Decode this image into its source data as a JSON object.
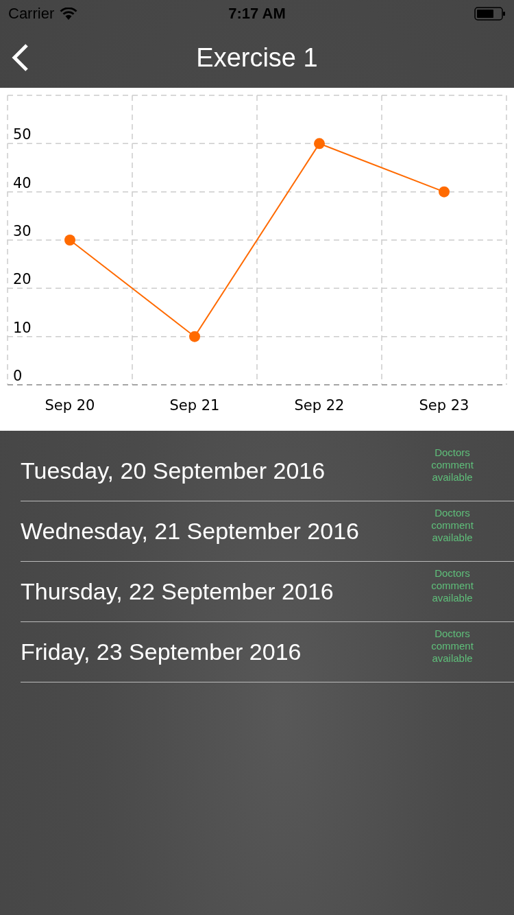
{
  "status_bar": {
    "carrier": "Carrier",
    "time": "7:17 AM"
  },
  "nav": {
    "title": "Exercise 1"
  },
  "chart": {
    "chart_data": {
      "type": "line",
      "categories": [
        "Sep 20",
        "Sep 21",
        "Sep 22",
        "Sep 23"
      ],
      "grid": true,
      "series": [
        {
          "color": "#ff6a00",
          "marker": true,
          "values": [
            30,
            10,
            50,
            40
          ]
        }
      ],
      "ylim": [
        0,
        60
      ],
      "yticks": [
        0,
        10,
        20,
        30,
        40,
        50
      ]
    }
  },
  "entries": [
    {
      "date": "Tuesday, 20 September 2016",
      "note": "Doctors comment available"
    },
    {
      "date": "Wednesday, 21 September 2016",
      "note": "Doctors comment available"
    },
    {
      "date": "Thursday, 22 September 2016",
      "note": "Doctors comment available"
    },
    {
      "date": "Friday, 23 September 2016",
      "note": "Doctors comment available"
    }
  ]
}
